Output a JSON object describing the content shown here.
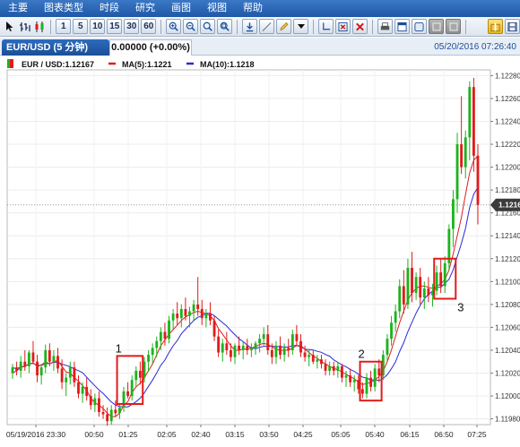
{
  "menu": [
    "主要",
    "图表类型",
    "时段",
    "研究",
    "画图",
    "视图",
    "帮助"
  ],
  "toolbar": {
    "period_buttons": [
      "1",
      "5",
      "10",
      "15",
      "30",
      "60"
    ]
  },
  "tab": {
    "symbol": "EUR/USD (5 分钟)",
    "change": "0.00000 (+0.00%)",
    "datetime": "05/20/2016 07:26:40"
  },
  "legend": {
    "symbol_label": "EUR / USD:1.12167",
    "ma5_label": "MA(5):1.1221",
    "ma10_label": "MA(10):1.1218",
    "ma5_color": "#e11b1b",
    "ma10_color": "#2a2ad6"
  },
  "chart_data": {
    "type": "candlestick",
    "ylim": [
      1.11975,
      1.12285
    ],
    "y_ticks": [
      "1.12280",
      "1.12260",
      "1.12240",
      "1.12220",
      "1.12200",
      "1.12180",
      "1.12160",
      "1.12140",
      "1.12120",
      "1.12100",
      "1.12080",
      "1.12060",
      "1.12040",
      "1.12020",
      "1.12000",
      "1.11980"
    ],
    "x_ticks": [
      "05/19/2016 23:30",
      "00:50",
      "01:25",
      "02:05",
      "02:40",
      "03:15",
      "03:50",
      "04:25",
      "05:05",
      "05:40",
      "06:15",
      "06:50",
      "07:25"
    ],
    "current_price": "1.12167",
    "up_color": "#1db31d",
    "down_color": "#e21b1b",
    "annotations": [
      {
        "label": "1",
        "from_index": 26,
        "to_index": 31,
        "low": 1.11993,
        "high": 1.12035
      },
      {
        "label": "2",
        "from_index": 85,
        "to_index": 89,
        "low": 1.11996,
        "high": 1.1203
      },
      {
        "label": "3",
        "from_index": 103,
        "to_index": 107,
        "low": 1.12085,
        "high": 1.1212
      }
    ],
    "ohlc": [
      [
        1.1202,
        1.12028,
        1.12015,
        1.12025
      ],
      [
        1.12025,
        1.1203,
        1.12018,
        1.12022
      ],
      [
        1.12022,
        1.12035,
        1.12016,
        1.1203
      ],
      [
        1.1203,
        1.1204,
        1.12022,
        1.12026
      ],
      [
        1.12026,
        1.1204,
        1.1202,
        1.12038
      ],
      [
        1.12038,
        1.12048,
        1.12028,
        1.1203
      ],
      [
        1.1203,
        1.12036,
        1.12012,
        1.12018
      ],
      [
        1.12018,
        1.12028,
        1.1201,
        1.12025
      ],
      [
        1.12025,
        1.12045,
        1.1202,
        1.1204
      ],
      [
        1.1204,
        1.12046,
        1.12026,
        1.1203
      ],
      [
        1.1203,
        1.1204,
        1.12022,
        1.12035
      ],
      [
        1.12035,
        1.12042,
        1.1202,
        1.12024
      ],
      [
        1.12024,
        1.12032,
        1.12006,
        1.12012
      ],
      [
        1.12012,
        1.1202,
        1.12,
        1.12016
      ],
      [
        1.12016,
        1.1203,
        1.1201,
        1.12025
      ],
      [
        1.12025,
        1.1203,
        1.12008,
        1.12012
      ],
      [
        1.12012,
        1.12018,
        1.11998,
        1.12002
      ],
      [
        1.12002,
        1.12012,
        1.11994,
        1.12008
      ],
      [
        1.12008,
        1.12016,
        1.11996,
        1.12
      ],
      [
        1.12,
        1.12006,
        1.11988,
        1.11992
      ],
      [
        1.11992,
        1.12002,
        1.11986,
        1.11998
      ],
      [
        1.11998,
        1.12004,
        1.11982,
        1.11986
      ],
      [
        1.11986,
        1.11992,
        1.1198,
        1.11984
      ],
      [
        1.11984,
        1.1199,
        1.11974,
        1.11978
      ],
      [
        1.11978,
        1.11992,
        1.11975,
        1.11988
      ],
      [
        1.11988,
        1.11996,
        1.11982,
        1.11985
      ],
      [
        1.11985,
        1.11994,
        1.1198,
        1.1199
      ],
      [
        1.1199,
        1.12008,
        1.11986,
        1.12004
      ],
      [
        1.12004,
        1.12012,
        1.11998,
        1.12
      ],
      [
        1.12,
        1.12018,
        1.11996,
        1.12014
      ],
      [
        1.12014,
        1.12026,
        1.12008,
        1.12022
      ],
      [
        1.12022,
        1.1203,
        1.1201,
        1.12016
      ],
      [
        1.12016,
        1.12034,
        1.12012,
        1.1203
      ],
      [
        1.1203,
        1.1204,
        1.12022,
        1.12036
      ],
      [
        1.12036,
        1.12046,
        1.12028,
        1.12042
      ],
      [
        1.12042,
        1.12052,
        1.12034,
        1.12048
      ],
      [
        1.12048,
        1.1206,
        1.1204,
        1.12056
      ],
      [
        1.12056,
        1.12064,
        1.12044,
        1.1205
      ],
      [
        1.1205,
        1.1207,
        1.12046,
        1.12066
      ],
      [
        1.12066,
        1.12076,
        1.12058,
        1.12072
      ],
      [
        1.12072,
        1.12082,
        1.12062,
        1.12068
      ],
      [
        1.12068,
        1.1208,
        1.1206,
        1.12076
      ],
      [
        1.12076,
        1.12086,
        1.12066,
        1.1207
      ],
      [
        1.1207,
        1.12078,
        1.1206,
        1.12074
      ],
      [
        1.12074,
        1.12084,
        1.12066,
        1.1208
      ],
      [
        1.1208,
        1.12104,
        1.1207,
        1.12076
      ],
      [
        1.12076,
        1.12084,
        1.12062,
        1.12068
      ],
      [
        1.12068,
        1.12076,
        1.1206,
        1.12072
      ],
      [
        1.12072,
        1.12082,
        1.12062,
        1.12066
      ],
      [
        1.12066,
        1.1207,
        1.12048,
        1.12052
      ],
      [
        1.12052,
        1.12058,
        1.12034,
        1.12038
      ],
      [
        1.12038,
        1.1205,
        1.1203,
        1.12046
      ],
      [
        1.12046,
        1.12056,
        1.12036,
        1.1204
      ],
      [
        1.1204,
        1.12046,
        1.1203,
        1.12034
      ],
      [
        1.12034,
        1.12046,
        1.12028,
        1.12044
      ],
      [
        1.12044,
        1.12052,
        1.12036,
        1.1204
      ],
      [
        1.1204,
        1.12048,
        1.12032,
        1.12044
      ],
      [
        1.12044,
        1.1205,
        1.12036,
        1.1204
      ],
      [
        1.1204,
        1.12046,
        1.12034,
        1.12042
      ],
      [
        1.12042,
        1.12048,
        1.12036,
        1.12046
      ],
      [
        1.12046,
        1.12054,
        1.12038,
        1.1205
      ],
      [
        1.1205,
        1.1206,
        1.12044,
        1.12054
      ],
      [
        1.12054,
        1.12062,
        1.12036,
        1.1204
      ],
      [
        1.1204,
        1.12046,
        1.12028,
        1.12034
      ],
      [
        1.12034,
        1.12048,
        1.12028,
        1.12044
      ],
      [
        1.12044,
        1.12052,
        1.12032,
        1.12036
      ],
      [
        1.12036,
        1.12046,
        1.1203,
        1.12042
      ],
      [
        1.12042,
        1.1205,
        1.12034,
        1.1204
      ],
      [
        1.1204,
        1.12058,
        1.12036,
        1.12054
      ],
      [
        1.12054,
        1.12062,
        1.12044,
        1.12048
      ],
      [
        1.12048,
        1.12054,
        1.12034,
        1.12038
      ],
      [
        1.12038,
        1.12044,
        1.1203,
        1.12034
      ],
      [
        1.12034,
        1.1204,
        1.12026,
        1.12036
      ],
      [
        1.12036,
        1.1204,
        1.12028,
        1.1203
      ],
      [
        1.1203,
        1.12036,
        1.12024,
        1.12032
      ],
      [
        1.12032,
        1.12036,
        1.12024,
        1.12028
      ],
      [
        1.12028,
        1.12032,
        1.12018,
        1.12022
      ],
      [
        1.12022,
        1.1203,
        1.12018,
        1.12026
      ],
      [
        1.12026,
        1.1203,
        1.12018,
        1.12022
      ],
      [
        1.12022,
        1.1203,
        1.12016,
        1.12026
      ],
      [
        1.12026,
        1.12028,
        1.12012,
        1.12016
      ],
      [
        1.12016,
        1.12022,
        1.12008,
        1.12018
      ],
      [
        1.12018,
        1.12024,
        1.12008,
        1.12012
      ],
      [
        1.12012,
        1.12018,
        1.12004,
        1.12014
      ],
      [
        1.12014,
        1.12018,
        1.12002,
        1.12006
      ],
      [
        1.12006,
        1.12012,
        1.11998,
        1.12002
      ],
      [
        1.12002,
        1.1202,
        1.11998,
        1.12016
      ],
      [
        1.12016,
        1.12022,
        1.12004,
        1.12008
      ],
      [
        1.12008,
        1.12028,
        1.12004,
        1.12024
      ],
      [
        1.12024,
        1.12032,
        1.12012,
        1.12018
      ],
      [
        1.12018,
        1.1204,
        1.12014,
        1.12036
      ],
      [
        1.12036,
        1.12054,
        1.1203,
        1.1205
      ],
      [
        1.1205,
        1.1207,
        1.12044,
        1.12064
      ],
      [
        1.12064,
        1.1208,
        1.12056,
        1.12074
      ],
      [
        1.12074,
        1.12102,
        1.12068,
        1.12096
      ],
      [
        1.12096,
        1.1211,
        1.12072,
        1.1208
      ],
      [
        1.1208,
        1.1212,
        1.12076,
        1.12112
      ],
      [
        1.12112,
        1.12126,
        1.12082,
        1.1209
      ],
      [
        1.1209,
        1.12108,
        1.12084,
        1.12104
      ],
      [
        1.12104,
        1.12112,
        1.1208,
        1.12086
      ],
      [
        1.12086,
        1.121,
        1.12076,
        1.12094
      ],
      [
        1.12094,
        1.12104,
        1.12082,
        1.12088
      ],
      [
        1.12088,
        1.12098,
        1.12078,
        1.12092
      ],
      [
        1.12092,
        1.12114,
        1.12088,
        1.12108
      ],
      [
        1.12108,
        1.1212,
        1.1209,
        1.12096
      ],
      [
        1.12096,
        1.12122,
        1.1209,
        1.12116
      ],
      [
        1.12116,
        1.1215,
        1.1211,
        1.12146
      ],
      [
        1.12146,
        1.1218,
        1.1213,
        1.12172
      ],
      [
        1.12172,
        1.1223,
        1.1216,
        1.1222
      ],
      [
        1.1222,
        1.12262,
        1.12194,
        1.122
      ],
      [
        1.122,
        1.12232,
        1.1219,
        1.12226
      ],
      [
        1.12226,
        1.12275,
        1.12206,
        1.1227
      ],
      [
        1.1227,
        1.12278,
        1.12196,
        1.1221
      ],
      [
        1.1221,
        1.1222,
        1.1215,
        1.12167
      ]
    ],
    "ma5": [
      1.1202,
      1.12022,
      1.12025,
      1.12026,
      1.12028,
      1.12029,
      1.12026,
      1.12027,
      1.1203,
      1.12028,
      1.1203,
      1.12031,
      1.12026,
      1.12021,
      1.1202,
      1.12016,
      1.12013,
      1.12009,
      1.12005,
      1.11998,
      1.11994,
      1.11992,
      1.11989,
      1.11985,
      1.11982,
      1.11982,
      1.11985,
      1.11992,
      1.11995,
      1.12003,
      1.12008,
      1.12011,
      1.12016,
      1.12022,
      1.12028,
      1.12036,
      1.12044,
      1.12049,
      1.12054,
      1.12058,
      1.12062,
      1.12066,
      1.12069,
      1.12071,
      1.12073,
      1.12074,
      1.12073,
      1.12072,
      1.1207,
      1.12066,
      1.12059,
      1.12054,
      1.12049,
      1.12044,
      1.1204,
      1.1204,
      1.12041,
      1.12041,
      1.12042,
      1.12043,
      1.12045,
      1.12046,
      1.12045,
      1.12043,
      1.12041,
      1.1204,
      1.1204,
      1.1204,
      1.12042,
      1.12044,
      1.12044,
      1.12041,
      1.12038,
      1.12035,
      1.12033,
      1.1203,
      1.12028,
      1.12026,
      1.12024,
      1.12023,
      1.12021,
      1.12019,
      1.12017,
      1.12015,
      1.12012,
      1.1201,
      1.12011,
      1.12012,
      1.12014,
      1.12017,
      1.12022,
      1.1203,
      1.1204,
      1.12052,
      1.12064,
      1.12074,
      1.12084,
      1.1209,
      1.12094,
      1.12096,
      1.12096,
      1.12095,
      1.12094,
      1.12096,
      1.12098,
      1.12102,
      1.1211,
      1.12124,
      1.1214,
      1.12156,
      1.12176,
      1.12195,
      1.12206,
      1.1221
    ]
  }
}
